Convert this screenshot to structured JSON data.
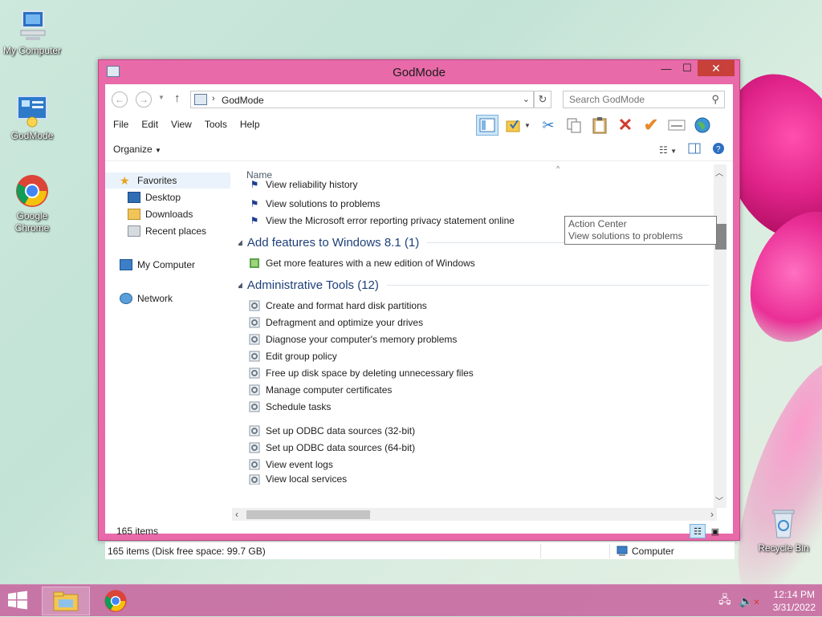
{
  "desktop": {
    "icons": [
      {
        "label": "My Computer"
      },
      {
        "label": "GodMode"
      },
      {
        "label": "Google Chrome"
      },
      {
        "label": "Recycle Bin"
      }
    ]
  },
  "window": {
    "title": "GodMode",
    "controls": {
      "minimize": "—",
      "maximize": "☐",
      "close": "✕"
    },
    "address": {
      "path": "GodMode",
      "separator": "›"
    },
    "search": {
      "placeholder": "Search GodMode"
    },
    "menu": [
      "File",
      "Edit",
      "View",
      "Tools",
      "Help"
    ],
    "command": {
      "organize": "Organize"
    },
    "nav": {
      "favorites": "Favorites",
      "desktop": "Desktop",
      "downloads": "Downloads",
      "recent": "Recent places",
      "computer": "My Computer",
      "network": "Network"
    },
    "list": {
      "column": "Name",
      "group0_items": [
        "View reliability history",
        "View solutions to problems",
        "View the Microsoft error reporting privacy statement online"
      ],
      "group1": {
        "title": "Add features to Windows 8.1 (1)",
        "items": [
          "Get more features with a new edition of Windows"
        ]
      },
      "group2": {
        "title": "Administrative Tools (12)",
        "items": [
          "Create and format hard disk partitions",
          "Defragment and optimize your drives",
          "Diagnose your computer's memory problems",
          "Edit group policy",
          "Free up disk space by deleting unnecessary files",
          "Manage computer certificates",
          "Schedule tasks",
          "Set up ODBC data sources (32-bit)",
          "Set up ODBC data sources (64-bit)",
          "View event logs",
          "View local services"
        ]
      }
    },
    "tooltip": {
      "line1": "Action Center",
      "line2": "View solutions to problems"
    },
    "status": {
      "count": "165 items",
      "bar_left": "165 items (Disk free space: 99.7 GB)",
      "bar_right": "Computer"
    }
  },
  "taskbar": {
    "time": "12:14 PM",
    "date": "3/31/2022"
  },
  "colors": {
    "accent": "#e86aa8",
    "close": "#c7403a",
    "group_title": "#1e3f79"
  }
}
